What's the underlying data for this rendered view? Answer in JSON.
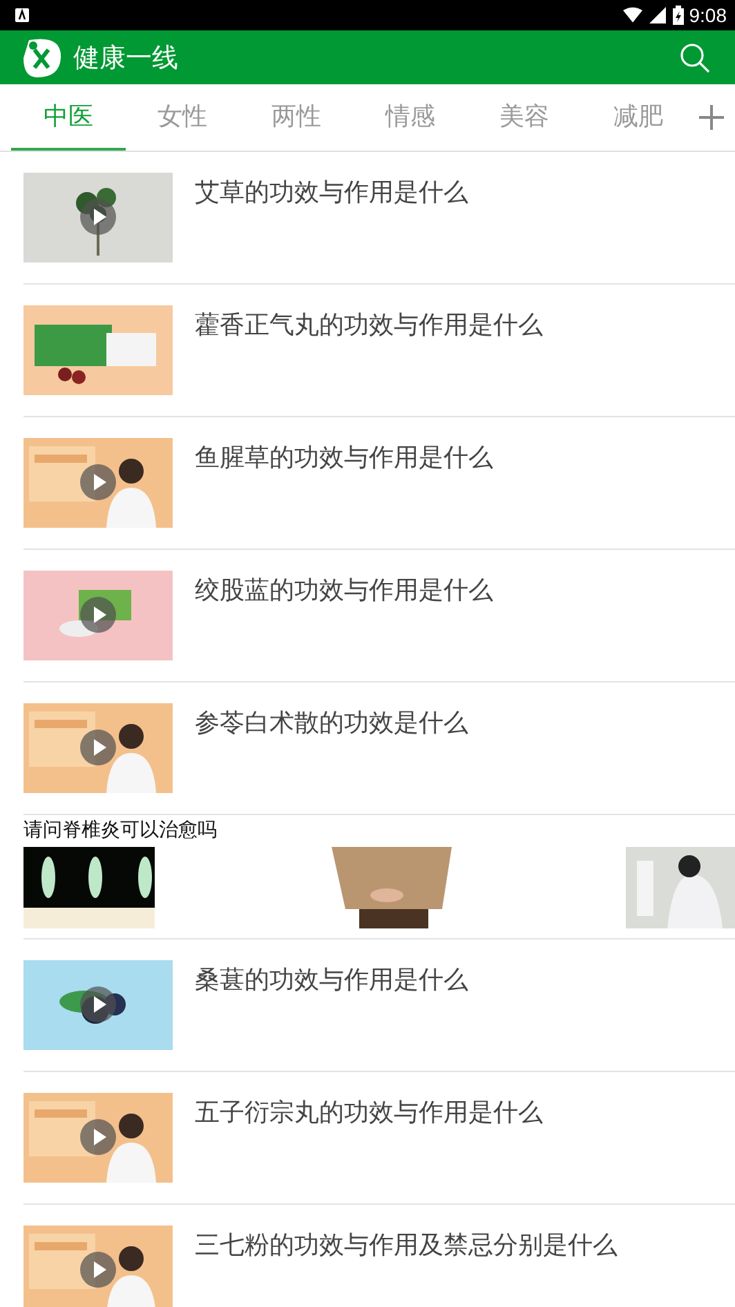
{
  "status_bar": {
    "time": "9:08"
  },
  "header": {
    "title": "健康一线"
  },
  "tabs": [
    {
      "label": "中医",
      "selected": true
    },
    {
      "label": "女性",
      "selected": false
    },
    {
      "label": "两性",
      "selected": false
    },
    {
      "label": "情感",
      "selected": false
    },
    {
      "label": "美容",
      "selected": false
    },
    {
      "label": "减肥",
      "selected": false
    }
  ],
  "articles": [
    {
      "title": "艾草的功效与作用是什么",
      "video": true
    },
    {
      "title": "藿香正气丸的功效与作用是什么",
      "video": false
    },
    {
      "title": "鱼腥草的功效与作用是什么",
      "video": true
    },
    {
      "title": "绞股蓝的功效与作用是什么",
      "video": true
    },
    {
      "title": "参苓白术散的功效是什么",
      "video": true
    }
  ],
  "ad": {
    "title": "请问脊椎炎可以治愈吗"
  },
  "more_articles": [
    {
      "title": "桑葚的功效与作用是什么",
      "video": true
    },
    {
      "title": "五子衍宗丸的功效与作用是什么",
      "video": true
    },
    {
      "title": "三七粉的功效与作用及禁忌分别是什么",
      "video": true
    }
  ]
}
